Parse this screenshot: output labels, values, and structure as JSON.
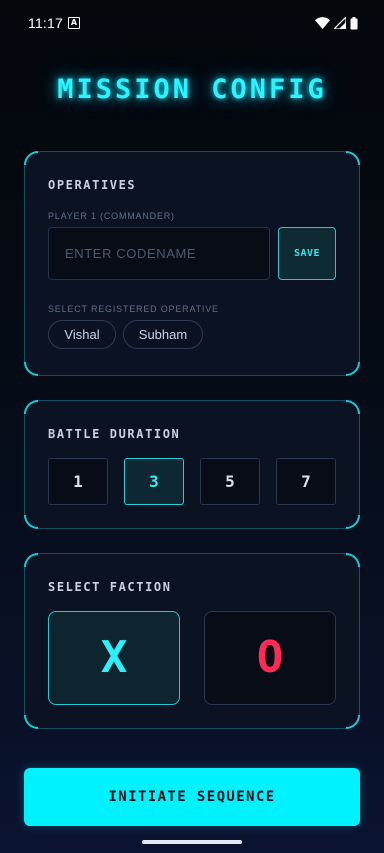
{
  "status_bar": {
    "time": "11:17",
    "notification_glyph": "A",
    "icons": [
      "wifi-icon",
      "cell-signal-icon",
      "battery-icon"
    ]
  },
  "title": "MISSION CONFIG",
  "operatives": {
    "heading": "OPERATIVES",
    "player_label": "PLAYER 1 (COMMANDER)",
    "codename_value": "",
    "codename_placeholder": "ENTER CODENAME",
    "save_label": "SAVE",
    "registered_label": "SELECT REGISTERED OPERATIVE",
    "registered": [
      "Vishal",
      "Subham"
    ]
  },
  "duration": {
    "heading": "BATTLE DURATION",
    "options": [
      "1",
      "3",
      "5",
      "7"
    ],
    "selected": "3"
  },
  "faction": {
    "heading": "SELECT FACTION",
    "options": [
      "X",
      "O"
    ],
    "selected": "X"
  },
  "initiate_label": "INITIATE SEQUENCE",
  "colors": {
    "accent": "#00f2ff",
    "danger": "#ff2b55",
    "card_bg": "#0b1322",
    "background": "#050b14"
  }
}
